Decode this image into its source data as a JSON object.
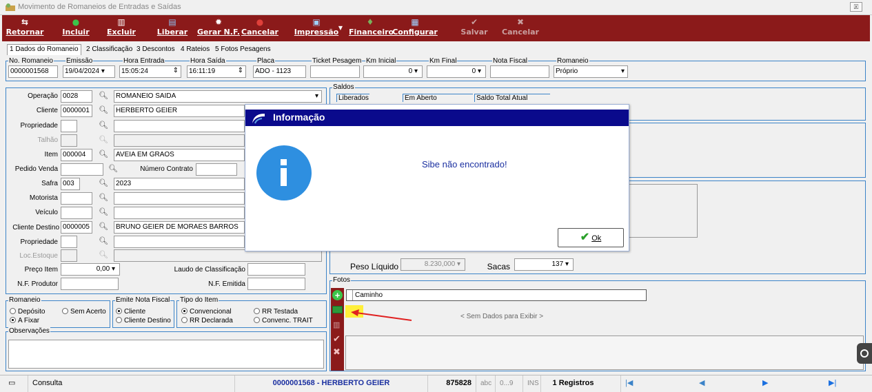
{
  "window": {
    "title": "Movimento de Romaneios de Entradas e Saídas",
    "close_label": "🗵"
  },
  "toolbar": {
    "retornar": "Retornar",
    "incluir": "Incluir",
    "excluir": "Excluir",
    "liberar": "Liberar",
    "gerar_nf": "Gerar N.F.",
    "cancelar": "Cancelar",
    "impressao": "Impressão",
    "financeiro": "Financeiro",
    "configurar": "Configurar",
    "salvar": "Salvar",
    "cancelar2": "Cancelar"
  },
  "tabs": [
    "1 Dados do Romaneio",
    "2 Classificação",
    "3 Descontos",
    "4 Rateios",
    "5 Fotos Pesagens"
  ],
  "header_fields": {
    "no_romaneio_label": "No. Romaneio",
    "no_romaneio": "0000001568",
    "emissao_label": "Emissão",
    "emissao": "19/04/2024",
    "hora_entrada_label": "Hora Entrada",
    "hora_entrada": "15:05:24",
    "hora_saida_label": "Hora Saída",
    "hora_saida": "16:11:19",
    "placa_label": "Placa",
    "placa": "ADO - 1123",
    "ticket_label": "Ticket Pesagem",
    "ticket": "",
    "km_inicial_label": "Km Inicial",
    "km_inicial": "0",
    "km_final_label": "Km Final",
    "km_final": "0",
    "nota_fiscal_label": "Nota Fiscal",
    "nota_fiscal": "",
    "romaneio_label": "Romaneio",
    "romaneio": "Próprio"
  },
  "form": {
    "operacao_label": "Operação",
    "operacao_code": "0028",
    "operacao_desc": "ROMANEIO SAIDA",
    "cliente_label": "Cliente",
    "cliente_code": "0000001",
    "cliente_desc": "HERBERTO GEIER",
    "propriedade_label": "Propriedade",
    "talhao_label": "Talhão",
    "item_label": "Item",
    "item_code": "000004",
    "item_desc": "AVEIA EM GRAOS",
    "pedido_label": "Pedido Venda",
    "numero_contrato_label": "Número Contrato",
    "safra_label": "Safra",
    "safra_code": "003",
    "safra_desc": "2023",
    "motorista_label": "Motorista",
    "veiculo_label": "Veículo",
    "cliente_destino_label": "Cliente Destino",
    "cliente_destino_code": "0000005",
    "cliente_destino_desc": "BRUNO GEIER DE MORAES BARROS",
    "propriedade2_label": "Propriedade",
    "loc_estoque_label": "Loc.Estoque",
    "preco_item_label": "Preço Item",
    "preco_item": "0,00",
    "laudo_label": "Laudo de Classificação",
    "nf_produtor_label": "N.F. Produtor",
    "nf_emitida_label": "N.F. Emitida"
  },
  "groups": {
    "romaneio_title": "Romaneio",
    "deposito": "Depósito",
    "sem_acerto": "Sem Acerto",
    "a_fixar": "A Fixar",
    "emite_nf_title": "Emite Nota Fiscal",
    "cliente": "Cliente",
    "cliente_destino": "Cliente Destino",
    "tipo_item_title": "Tipo do Item",
    "convencional": "Convencional",
    "rr_testada": "RR Testada",
    "rr_declarada": "RR Declarada",
    "convenc_trait": "Convenc. TRAIT",
    "observacoes_title": "Observações"
  },
  "saldos": {
    "title": "Saldos",
    "liberados": "Liberados",
    "em_aberto": "Em Aberto",
    "saldo_total": "Saldo Total Atual"
  },
  "peso": {
    "peso_liquido_label": "Peso Líquido",
    "peso_liquido": "8.230,000",
    "sacas_label": "Sacas",
    "sacas": "137"
  },
  "fotos": {
    "title": "Fotos",
    "col_caminho": "Caminho",
    "empty": "< Sem Dados para Exibir >"
  },
  "dialog": {
    "title": "Informação",
    "message": "Sibe não encontrado!",
    "ok_label": "Ok"
  },
  "status": {
    "mode": "Consulta",
    "record": "0000001568 - HERBERTO GEIER",
    "code": "875828",
    "abc": "abc",
    "nums": "0...9",
    "ins": "INS",
    "registros": "1 Registros"
  },
  "colors": {
    "toolbar": "#8b1a1a",
    "accent": "#3b83c8",
    "dialog_head": "#0a0a8c",
    "message": "#1a2fa0"
  }
}
